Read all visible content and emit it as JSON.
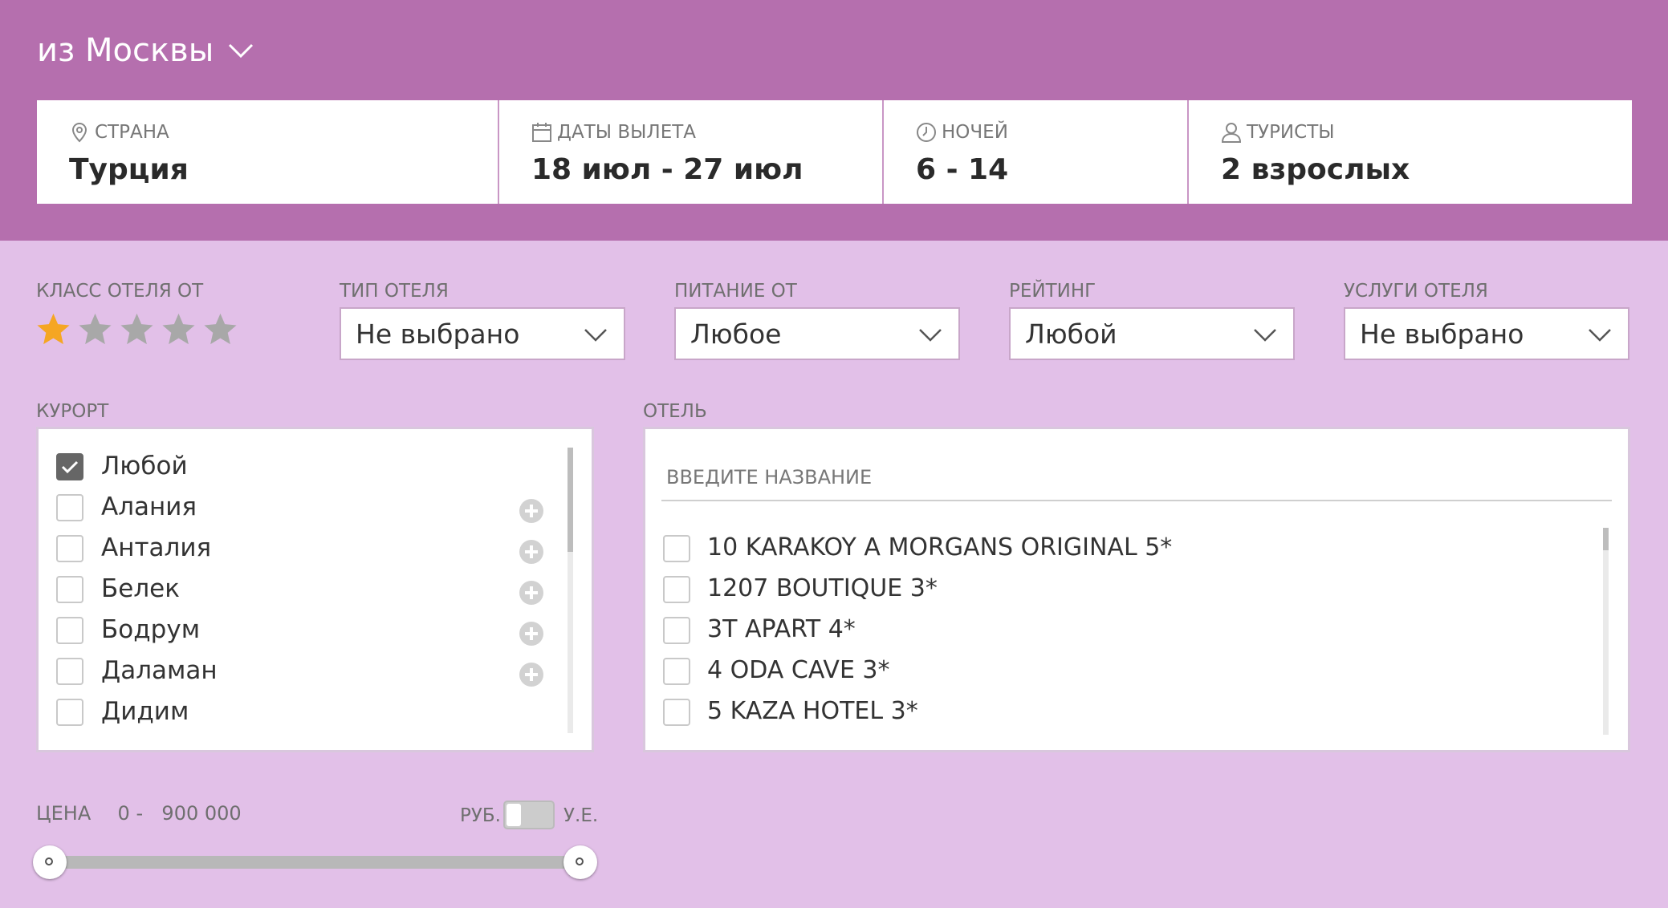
{
  "header": {
    "origin_label": "из Москвы",
    "bg_color": "#b56fae",
    "search": {
      "country": {
        "label": "Страна",
        "value": "Турция"
      },
      "dates": {
        "label": "Даты вылета",
        "value": "18 июл - 27 июл"
      },
      "nights": {
        "label": "Ночей",
        "value": "6 - 14"
      },
      "tourists": {
        "label": "Туристы",
        "value": "2 взрослых"
      }
    }
  },
  "filters": {
    "hotel_class": {
      "label": "Класс отеля от",
      "stars_selected": 1,
      "stars_total": 5
    },
    "hotel_type": {
      "label": "Тип отеля",
      "value": "Не выбрано"
    },
    "meal": {
      "label": "Питание от",
      "value": "Любое"
    },
    "rating": {
      "label": "Рейтинг",
      "value": "Любой"
    },
    "services": {
      "label": "Услуги отеля",
      "value": "Не выбрано"
    }
  },
  "resort": {
    "label": "Курорт",
    "items": [
      {
        "name": "Любой",
        "checked": true
      },
      {
        "name": "Алания",
        "checked": false
      },
      {
        "name": "Анталия",
        "checked": false
      },
      {
        "name": "Белек",
        "checked": false
      },
      {
        "name": "Бодрум",
        "checked": false
      },
      {
        "name": "Даламан",
        "checked": false
      },
      {
        "name": "Дидим",
        "checked": false
      }
    ]
  },
  "hotel": {
    "label": "Отель",
    "placeholder": "ВВЕДИТЕ НАЗВАНИЕ",
    "items": [
      "10 KARAKOY A MORGANS ORIGINAL 5*",
      "1207 BOUTIQUE 3*",
      "3T APART 4*",
      "4 ODA CAVE 3*",
      "5 KAZA HOTEL 3*"
    ]
  },
  "price": {
    "label": "Цена",
    "min": "0",
    "separator": "-",
    "max": "900 000",
    "currency_rub": "РУБ.",
    "currency_ue": "У.Е."
  },
  "colors": {
    "accent": "#b56fae",
    "panel": "#e2c0e8",
    "star_on": "#f5a623",
    "star_off": "#a8a8a8"
  }
}
